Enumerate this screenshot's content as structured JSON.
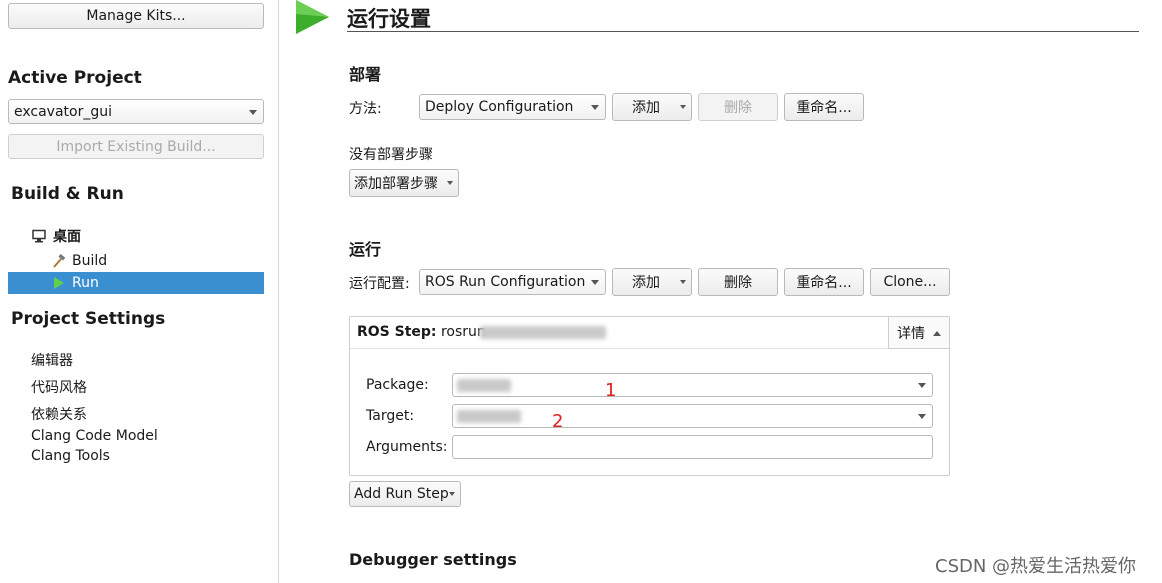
{
  "sidebar": {
    "manage_kits": "Manage Kits...",
    "active_project_heading": "Active Project",
    "active_project": "excavator_gui",
    "import_build": "Import Existing Build...",
    "build_run_heading": "Build & Run",
    "kit": "桌面",
    "build": "Build",
    "run": "Run",
    "project_settings_heading": "Project Settings",
    "settings_items": [
      "编辑器",
      "代码风格",
      "依赖关系",
      "Clang Code Model",
      "Clang Tools"
    ]
  },
  "main": {
    "title": "运行设置",
    "deploy": {
      "heading": "部署",
      "method_label": "方法:",
      "method_value": "Deploy Configuration",
      "add": "添加",
      "remove": "删除",
      "rename": "重命名...",
      "no_steps": "没有部署步骤",
      "add_step": "添加部署步骤"
    },
    "run": {
      "heading": "运行",
      "config_label": "运行配置:",
      "config_value": "ROS Run Configuration",
      "add": "添加",
      "remove": "删除",
      "rename": "重命名...",
      "clone": "Clone...",
      "step": {
        "title_bold": "ROS Step:",
        "title_rest": "rosrun",
        "details": "详情",
        "package_label": "Package:",
        "target_label": "Target:",
        "arguments_label": "Arguments:",
        "package_value": "",
        "target_value": "",
        "arguments_value": ""
      },
      "add_run_step": "Add Run Step",
      "annotation_1": "1",
      "annotation_2": "2"
    },
    "debugger_heading": "Debugger settings"
  },
  "watermark": "CSDN @热爱生活热爱你",
  "colors": {
    "selection": "#3a8fd0",
    "annotation": "#e02020",
    "run_triangle": "#3dae2b"
  }
}
